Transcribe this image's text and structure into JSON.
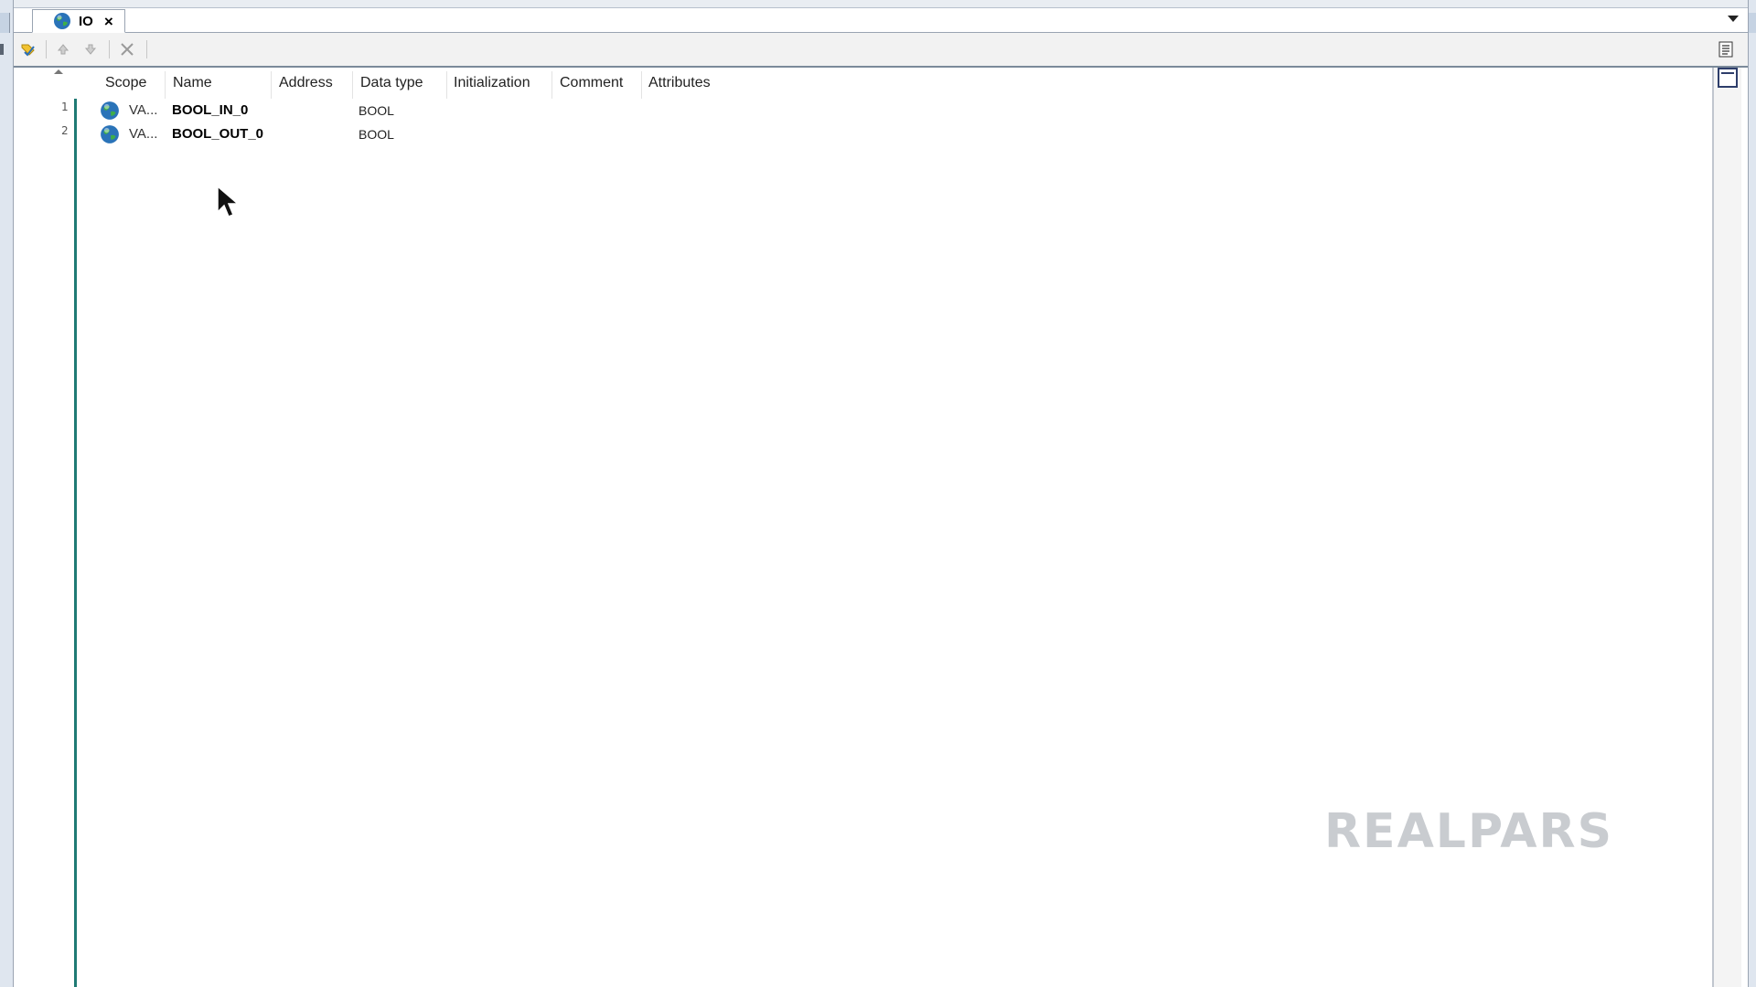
{
  "tab": {
    "title": "IO",
    "close_glyph": "×"
  },
  "toolbar": {
    "icons": [
      "add-variable-icon",
      "move-up-icon",
      "move-down-icon",
      "delete-icon"
    ]
  },
  "columns": [
    "Scope",
    "Name",
    "Address",
    "Data type",
    "Initialization",
    "Comment",
    "Attributes"
  ],
  "rows": [
    {
      "num": "1",
      "scope": "VA...",
      "name": "BOOL_IN_0",
      "address": "",
      "data_type": "BOOL",
      "initialization": "",
      "comment": "",
      "attributes": ""
    },
    {
      "num": "2",
      "scope": "VA...",
      "name": "BOOL_OUT_0",
      "address": "",
      "data_type": "BOOL",
      "initialization": "",
      "comment": "",
      "attributes": ""
    }
  ],
  "watermark": "REALPARS",
  "colors": {
    "accent_line": "#1f7a74",
    "frame": "#dfe6ef"
  }
}
